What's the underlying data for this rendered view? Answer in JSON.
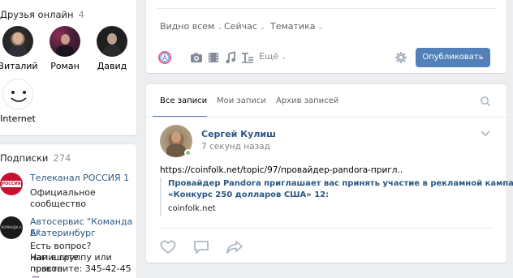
{
  "friends": {
    "title": "Друзья онлайн",
    "count": "4",
    "list": [
      {
        "name": "Виталий"
      },
      {
        "name": "Роман"
      },
      {
        "name": "Давид"
      },
      {
        "name": "Internet"
      }
    ]
  },
  "subscriptions": {
    "title": "Подписки",
    "count": "274",
    "items": [
      {
        "name": "Телеканал РОССИЯ 1",
        "desc_lines": [
          "Официальное",
          "сообщество"
        ],
        "logo_text": "РОССИЯ 1"
      },
      {
        "name_lines": [
          "Автосервис \"Команда А\"",
          "Екатеринбург"
        ],
        "desc_lines": [
          "Есть вопрос? Напишите",
          "нам в группу или просто",
          "позвоните: 345-42-45🚘"
        ],
        "logo_text": "КОМАНДА А"
      }
    ]
  },
  "composer": {
    "filters": [
      "Видно всем",
      "Сейчас",
      "Тематика"
    ],
    "more_label": "Ещё",
    "publish_label": "Опубликовать"
  },
  "feed": {
    "tabs": [
      "Все записи",
      "Мои записи",
      "Архив записей"
    ],
    "post": {
      "author": "Сергей Кулиш",
      "time": "7 секунд назад",
      "link": "https://coinfolk.net/topic/97/провайдер-pandora-пригл..",
      "snippet_title_lines": [
        "Провайдер Pandora приглашает вас принять участие в рекламной кампании",
        "«Конкурс 250 долларов США» 12:"
      ],
      "snippet_domain": "coinfolk.net"
    }
  },
  "colors": {
    "accent": "#5181b8",
    "link": "#2a5885",
    "background": "#edeef0"
  }
}
